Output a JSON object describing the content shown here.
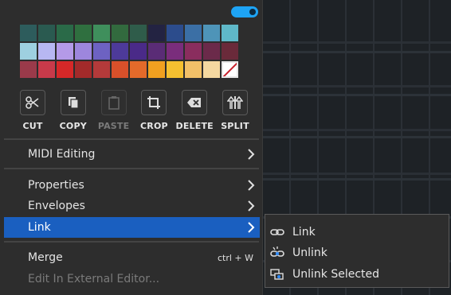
{
  "toggle": {
    "state": "on",
    "color": "#1ea4f5"
  },
  "palette": {
    "colors": [
      "#2d5c5c",
      "#2a5a50",
      "#2a6a48",
      "#2f6f3f",
      "#3f8f5c",
      "#326a3e",
      "#2f5c4a",
      "#232342",
      "#2c4c8c",
      "#3b6fa5",
      "#4e94b8",
      "#5fb8c8",
      "#84d5d0",
      "#9ed0e0",
      "#b7b7f2",
      "#b49ae8",
      "#9d86dd",
      "#6d62c2",
      "#4d3a9a",
      "#4a2a88",
      "#5a2c76",
      "#7a2d7c",
      "#8a2d5e",
      "#6b2a4a",
      "#6a2a3a",
      "#9a3a4a",
      "#c83a4a",
      "#d62828",
      "#a32a2a",
      "#b43a3a",
      "#d8502a",
      "#e46a2a",
      "#f0a020",
      "#f5c030",
      "#f2c068",
      "#f4d8a0"
    ],
    "none_swatch": "no-color"
  },
  "tools": [
    {
      "label": "CUT",
      "icon": "scissors-icon",
      "enabled": true
    },
    {
      "label": "COPY",
      "icon": "copy-icon",
      "enabled": true
    },
    {
      "label": "PASTE",
      "icon": "clipboard-icon",
      "enabled": false
    },
    {
      "label": "CROP",
      "icon": "crop-icon",
      "enabled": true
    },
    {
      "label": "DELETE",
      "icon": "delete-icon",
      "enabled": true
    },
    {
      "label": "SPLIT",
      "icon": "split-icon",
      "enabled": true
    }
  ],
  "menu": {
    "midi_editing": "MIDI Editing",
    "properties": "Properties",
    "envelopes": "Envelopes",
    "link": "Link",
    "merge": "Merge",
    "merge_shortcut": "ctrl + W",
    "edit_external": "Edit In External Editor..."
  },
  "submenu": {
    "link": "Link",
    "unlink": "Unlink",
    "unlink_selected": "Unlink Selected"
  },
  "colors": {
    "highlight": "#1a5fc0",
    "menu_bg": "#2d2d2d"
  }
}
